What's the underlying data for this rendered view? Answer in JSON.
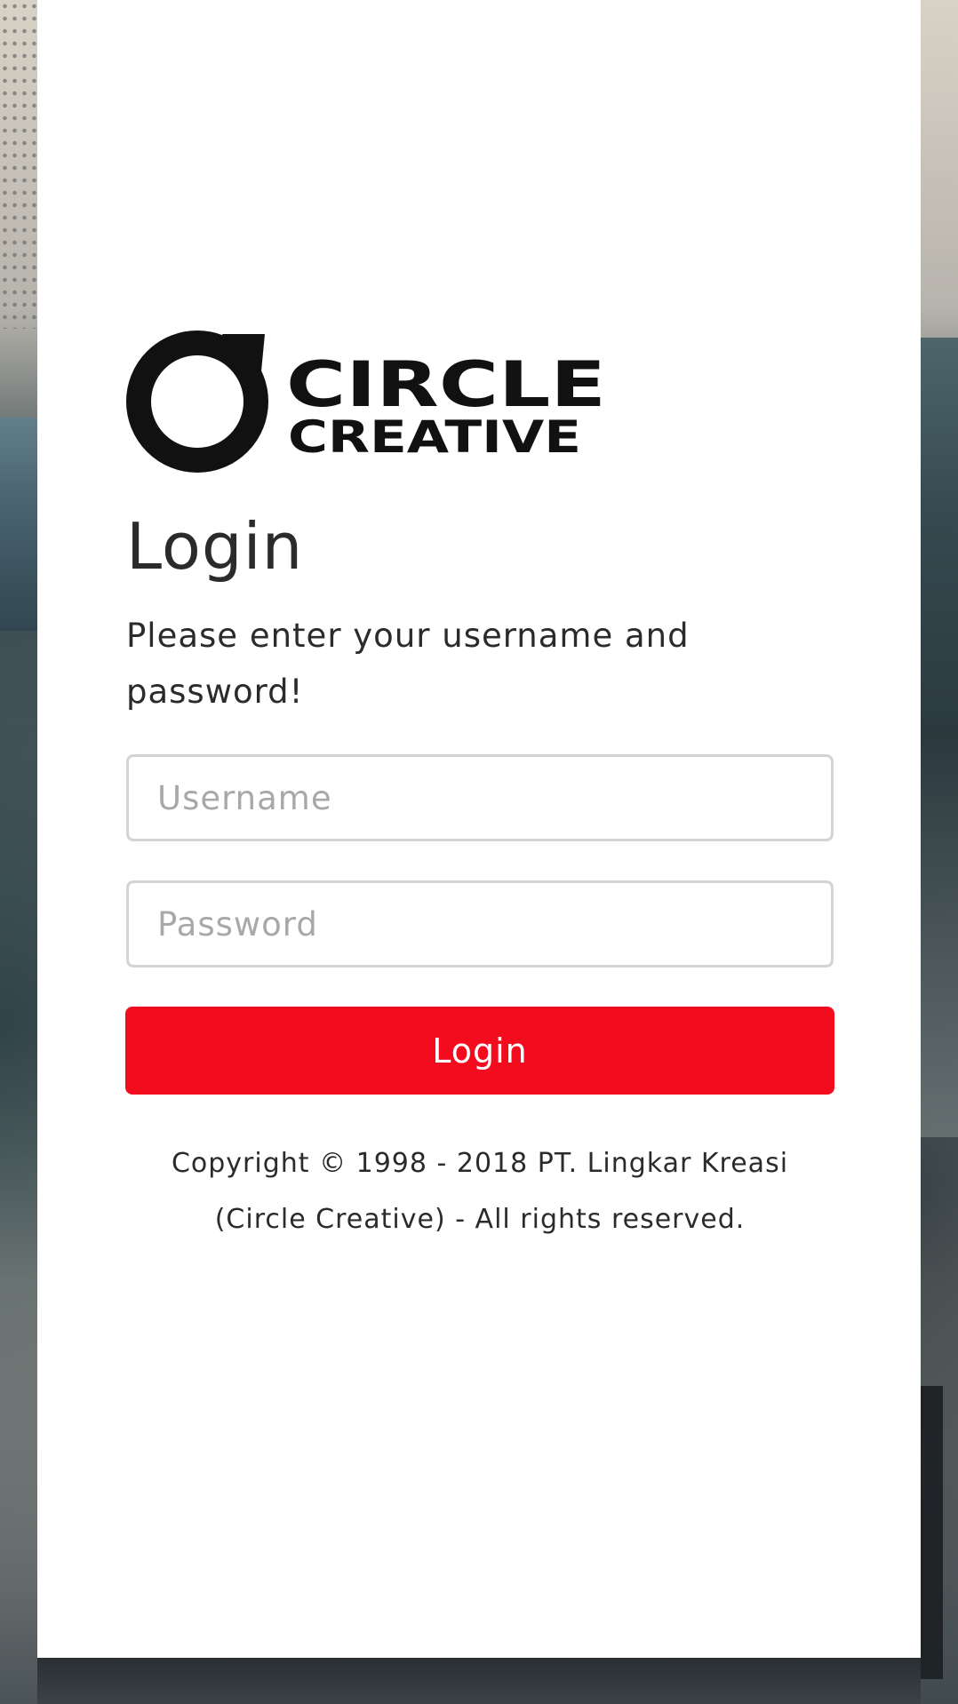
{
  "logo": {
    "line1": "CIRCLE",
    "line2": "CREATIVE"
  },
  "login": {
    "title": "Login",
    "subtitle": "Please enter your username and password!",
    "username_placeholder": "Username",
    "username_value": "",
    "password_placeholder": "Password",
    "password_value": "",
    "button_label": "Login"
  },
  "footer": {
    "copyright": "Copyright © 1998 - 2018 PT. Lingkar Kreasi (Circle Creative) - All rights reserved."
  },
  "colors": {
    "accent": "#f20c1e",
    "panel": "#ffffff",
    "text": "#2b2b2b",
    "placeholder": "#a8a8a8",
    "border": "#d4d4d4"
  }
}
